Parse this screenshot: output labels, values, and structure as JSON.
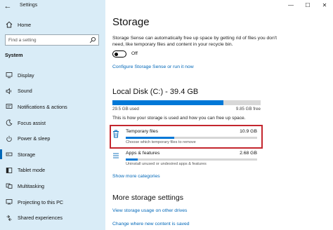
{
  "window": {
    "title": "Settings",
    "back_glyph": "←",
    "minimize_glyph": "—",
    "maximize_glyph": "☐",
    "close_glyph": "✕"
  },
  "sidebar": {
    "home_label": "Home",
    "search_placeholder": "Find a setting",
    "section_label": "System",
    "items": [
      {
        "label": "Display",
        "icon": "display-icon",
        "selected": false
      },
      {
        "label": "Sound",
        "icon": "sound-icon",
        "selected": false
      },
      {
        "label": "Notifications & actions",
        "icon": "notifications-icon",
        "selected": false
      },
      {
        "label": "Focus assist",
        "icon": "focus-assist-icon",
        "selected": false
      },
      {
        "label": "Power & sleep",
        "icon": "power-icon",
        "selected": false
      },
      {
        "label": "Storage",
        "icon": "storage-icon",
        "selected": true
      },
      {
        "label": "Tablet mode",
        "icon": "tablet-mode-icon",
        "selected": false
      },
      {
        "label": "Multitasking",
        "icon": "multitasking-icon",
        "selected": false
      },
      {
        "label": "Projecting to this PC",
        "icon": "projecting-icon",
        "selected": false
      },
      {
        "label": "Shared experiences",
        "icon": "shared-experiences-icon",
        "selected": false
      }
    ]
  },
  "main": {
    "title": "Storage",
    "description": "Storage Sense can automatically free up space by getting rid of files you don't need, like temporary files and content in your recycle bin.",
    "storage_sense_toggle": {
      "state_label": "Off",
      "on": false
    },
    "configure_link": "Configure Storage Sense or run it now",
    "disk": {
      "title": "Local Disk (C:) - 39.4 GB",
      "used_label": "29.5 GB used",
      "free_label": "9.85 GB free",
      "used_fraction": 0.75,
      "caption": "This is how your storage is used and how you can free up space."
    },
    "categories": [
      {
        "name": "Temporary files",
        "size": "10.9 GB",
        "subtitle": "Choose which temporary files to remove",
        "fraction": 0.37,
        "icon": "trash-icon",
        "highlighted": true
      },
      {
        "name": "Apps & features",
        "size": "2.68 GB",
        "subtitle": "Uninstall unused or undesired apps & features",
        "fraction": 0.09,
        "icon": "apps-icon",
        "highlighted": false
      }
    ],
    "show_more_link": "Show more categories",
    "more_heading": "More storage settings",
    "view_usage_link": "View storage usage on other drives",
    "change_new_content_link": "Change where new content is saved"
  },
  "colors": {
    "accent": "#0078d7",
    "sidebar_bg": "#d9ecf7",
    "highlight": "#c4262e",
    "link": "#0067b8"
  }
}
